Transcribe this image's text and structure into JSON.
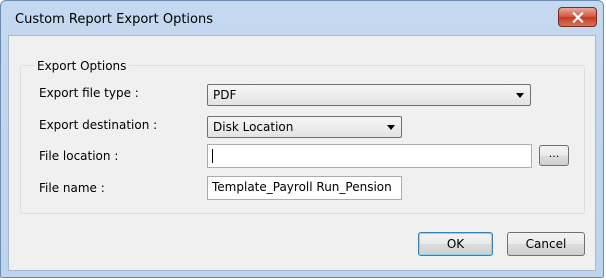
{
  "window": {
    "title": "Custom Report Export Options",
    "close_icon": "close-icon"
  },
  "group": {
    "legend": "Export Options"
  },
  "fields": {
    "file_type": {
      "label": "Export file type :",
      "value": "PDF"
    },
    "destination": {
      "label": "Export destination :",
      "value": "Disk Location"
    },
    "file_location": {
      "label": "File location :",
      "value": ""
    },
    "file_name": {
      "label": "File name :",
      "value": "Template_Payroll Run_Pension"
    }
  },
  "buttons": {
    "browse": "...",
    "ok": "OK",
    "cancel": "Cancel"
  },
  "colors": {
    "title_bar": "#c4d8ef",
    "client_bg": "#f0f0f0",
    "close_button": "#c23c1f",
    "default_button_border": "#3c7fb1"
  }
}
